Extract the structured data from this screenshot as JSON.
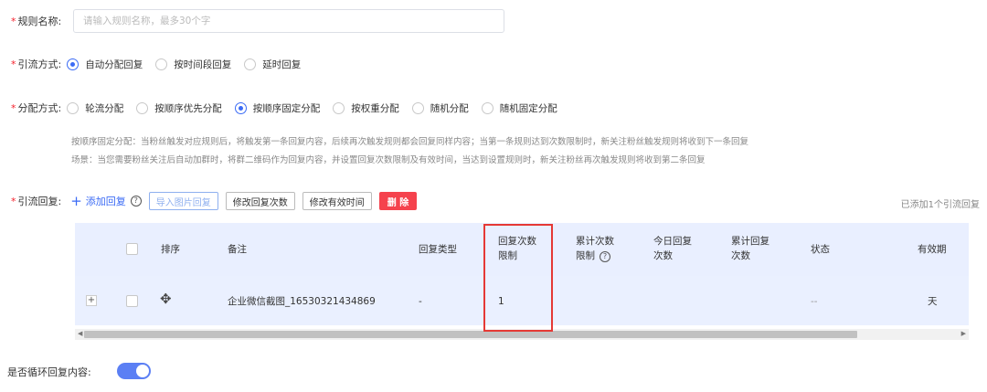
{
  "rule_name": {
    "label": "规则名称:",
    "placeholder": "请输入规则名称，最多30个字",
    "value": ""
  },
  "traffic_mode": {
    "label": "引流方式:",
    "options": [
      "自动分配回复",
      "按时间段回复",
      "延时回复"
    ],
    "selected": "自动分配回复"
  },
  "distribution_mode": {
    "label": "分配方式:",
    "options": [
      "轮流分配",
      "按顺序优先分配",
      "按顺序固定分配",
      "按权重分配",
      "随机分配",
      "随机固定分配"
    ],
    "selected": "按顺序固定分配",
    "description_1": "按顺序固定分配：当粉丝触发对应规则后，将触发第一条回复内容，后续再次触发规则都会回复同样内容；当第一条规则达到次数限制时，新关注粉丝触发规则将收到下一条回复",
    "description_2": "场景：当您需要粉丝关注后自动加群时，将群二维码作为回复内容，并设置回复次数限制及有效时间，当达到设置规则时，新关注粉丝再次触发规则将收到第二条回复"
  },
  "traffic_reply": {
    "label": "引流回复:",
    "add_label": "添加回复",
    "buttons": {
      "import_image": "导入图片回复",
      "edit_count": "修改回复次数",
      "edit_valid_time": "修改有效时间",
      "delete": "删 除"
    },
    "added_count_text": "已添加1个引流回复"
  },
  "table": {
    "headers": {
      "sort": "排序",
      "remark": "备注",
      "reply_type": "回复类型",
      "limit_line1": "回复次数",
      "limit_line2": "限制",
      "cumulative_limit_line1": "累计次数",
      "cumulative_limit_line2": "限制",
      "today_line1": "今日回复",
      "today_line2": "次数",
      "total_line1": "累计回复",
      "total_line2": "次数",
      "status": "状态",
      "validity": "有效期"
    },
    "rows": [
      {
        "expand": "+",
        "remark": "企业微信截图_16530321434869",
        "reply_type": "-",
        "limit": "1",
        "status": "--",
        "validity": "天"
      }
    ]
  },
  "loop_reply": {
    "label": "是否循环回复内容:",
    "enabled": true
  },
  "colors": {
    "accent": "#3b6bf5",
    "danger": "#f5424d",
    "highlight_border": "#e53935",
    "table_bg": "#e9efff"
  }
}
